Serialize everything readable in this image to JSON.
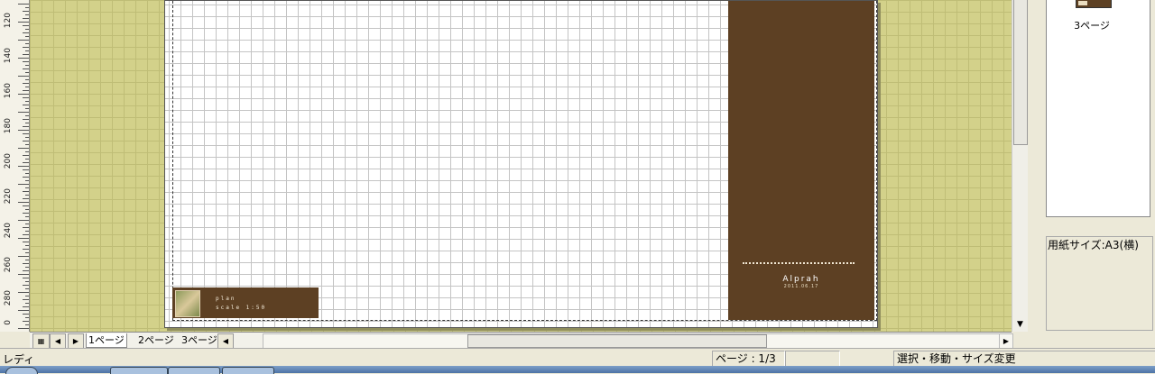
{
  "ruler": {
    "labels": [
      "120",
      "140",
      "160",
      "180",
      "200",
      "220",
      "240",
      "260",
      "280",
      "0"
    ]
  },
  "canvas": {
    "brand_name": "Alprah",
    "brand_date": "2011.06.17",
    "title_block": {
      "line1": "plan",
      "line2": "scale  1:50"
    }
  },
  "pages_panel": {
    "thumbnail_label": "3ページ",
    "paper_size": "用紙サイズ:A3(横)"
  },
  "sheet_tabs": {
    "tabs": [
      "1ページ",
      "2ページ",
      "3ページ"
    ],
    "active_index": 0
  },
  "status": {
    "ready": "レディ",
    "page": "ページ : 1/3",
    "mode": "選択・移動・サイズ変更"
  },
  "colors": {
    "workspace": "#d3d18a",
    "brown": "#5d4023"
  },
  "icons": [
    "grid-view-icon",
    "arrow-left-icon",
    "arrow-right-icon",
    "arrow-down-icon"
  ]
}
